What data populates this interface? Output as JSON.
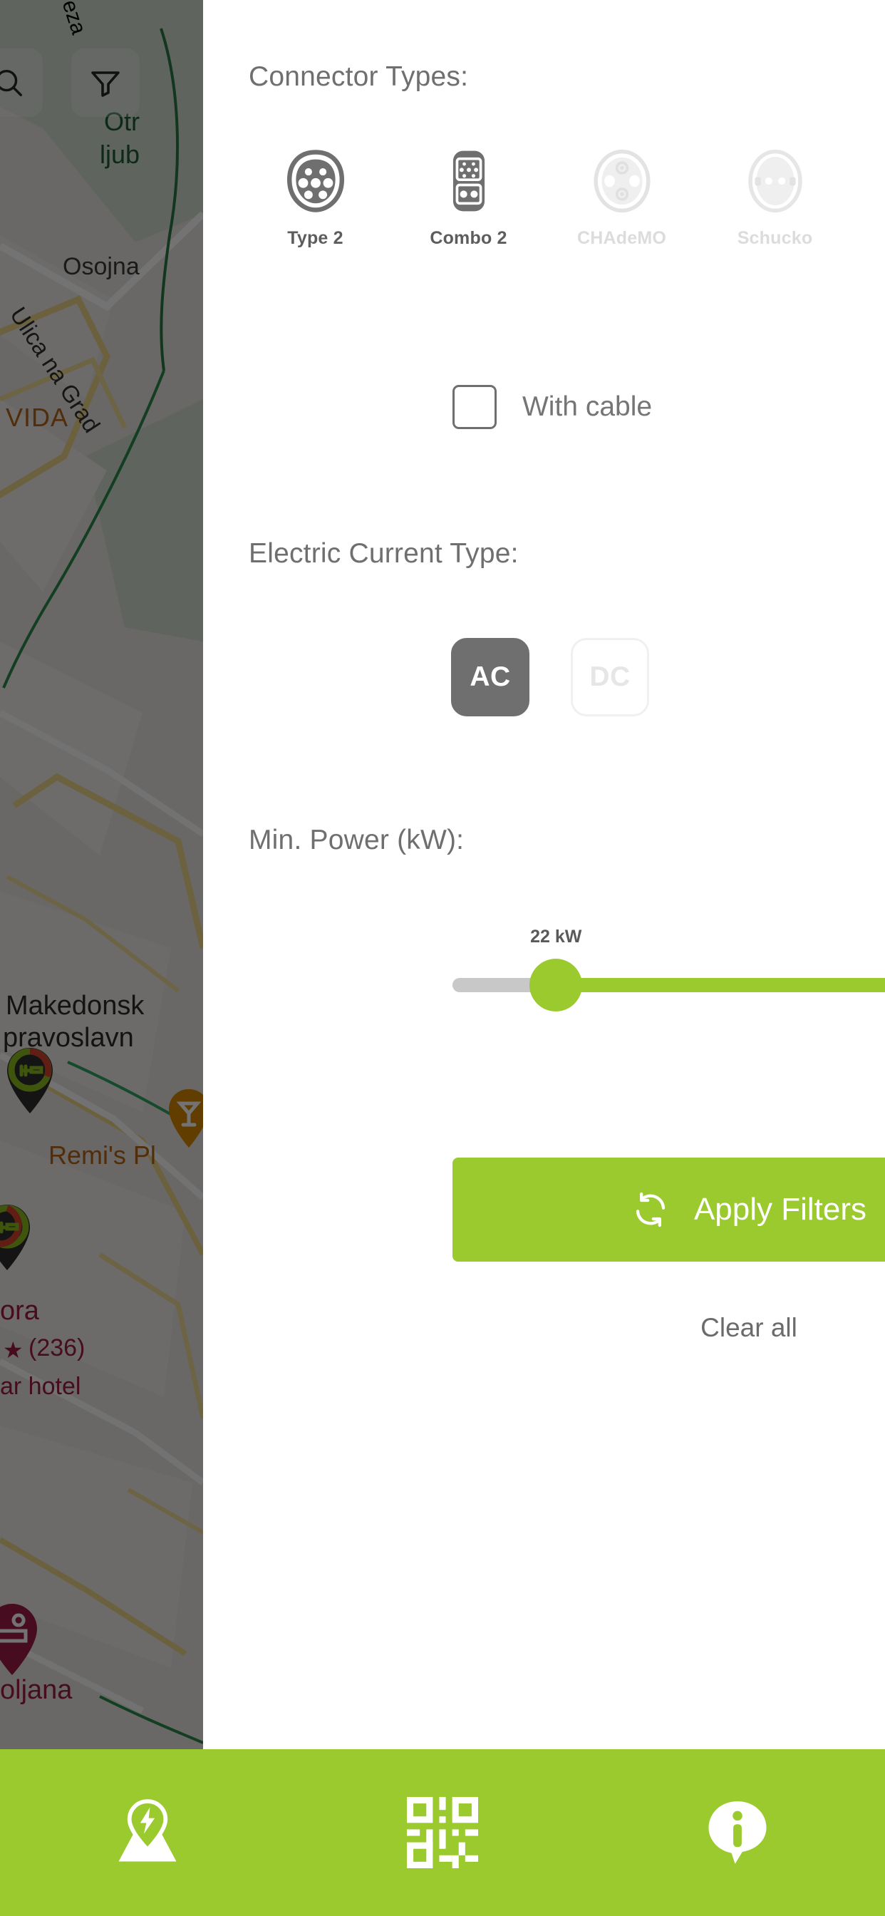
{
  "theme": {
    "brand_green": "#9ACA2E",
    "grey_active": "#6f6f6f",
    "grey_inactive": "#dcdcdc",
    "track_grey": "#c8c8c8",
    "panel_bg": "#ffffff"
  },
  "map": {
    "search_icon": "search-icon",
    "filter_icon": "filter-icon",
    "labels": [
      {
        "text": "eza",
        "color": "#2f2f2f"
      },
      {
        "text": "Otr",
        "color": "#1d5c34"
      },
      {
        "text": "ljub",
        "color": "#1d5c34"
      },
      {
        "text": "Osojna",
        "color": "#3a3a3a"
      },
      {
        "text": "Ulica na Grad",
        "color": "#303030"
      },
      {
        "text": "VIDA",
        "color": "#b3651a"
      },
      {
        "text": "Makedonsk",
        "color": "#2b2b2b"
      },
      {
        "text": "pravoslavn",
        "color": "#2b2b2b"
      },
      {
        "text": "Remi's Pl",
        "color": "#b3651a"
      },
      {
        "text": "ora",
        "color": "#9e1b45"
      },
      {
        "text": "(236)",
        "color": "#9e1b45"
      },
      {
        "text": "ar hotel",
        "color": "#9e1b45"
      },
      {
        "text": "oljana",
        "color": "#9e1b45"
      }
    ],
    "star_glyph": "★",
    "pins": [
      {
        "name": "restaurant-pin",
        "icon": "fork-icon"
      },
      {
        "name": "cocktail-pin",
        "icon": "cocktail-icon"
      },
      {
        "name": "restaurant-pin-2",
        "icon": "fork-icon"
      },
      {
        "name": "hotel-pin",
        "icon": "bed-icon"
      }
    ]
  },
  "filters": {
    "connector_types": {
      "title": "Connector Types:",
      "items": [
        {
          "label": "Type 2",
          "icon": "type2-connector-icon",
          "selected": true
        },
        {
          "label": "Combo 2",
          "icon": "combo2-connector-icon",
          "selected": true
        },
        {
          "label": "CHAdeMO",
          "icon": "chademo-connector-icon",
          "selected": false
        },
        {
          "label": "Schucko",
          "icon": "schucko-connector-icon",
          "selected": false
        }
      ]
    },
    "with_cable": {
      "label": "With cable",
      "checked": false
    },
    "current_type": {
      "title": "Electric Current Type:",
      "options": [
        {
          "label": "AC",
          "selected": true
        },
        {
          "label": "DC",
          "selected": false
        }
      ]
    },
    "min_power": {
      "title": "Min. Power (kW):",
      "value_label": "22 kW",
      "value": 22,
      "min": 0,
      "max": 150,
      "percent": 17.5
    },
    "apply_label": "Apply Filters",
    "apply_icon": "refresh-icon",
    "clear_label": "Clear all"
  },
  "bottom_nav": {
    "items": [
      {
        "name": "map-tab",
        "icon": "map-pin-charger-icon"
      },
      {
        "name": "scan-tab",
        "icon": "qr-code-icon"
      },
      {
        "name": "info-tab",
        "icon": "info-bubble-icon"
      }
    ]
  }
}
